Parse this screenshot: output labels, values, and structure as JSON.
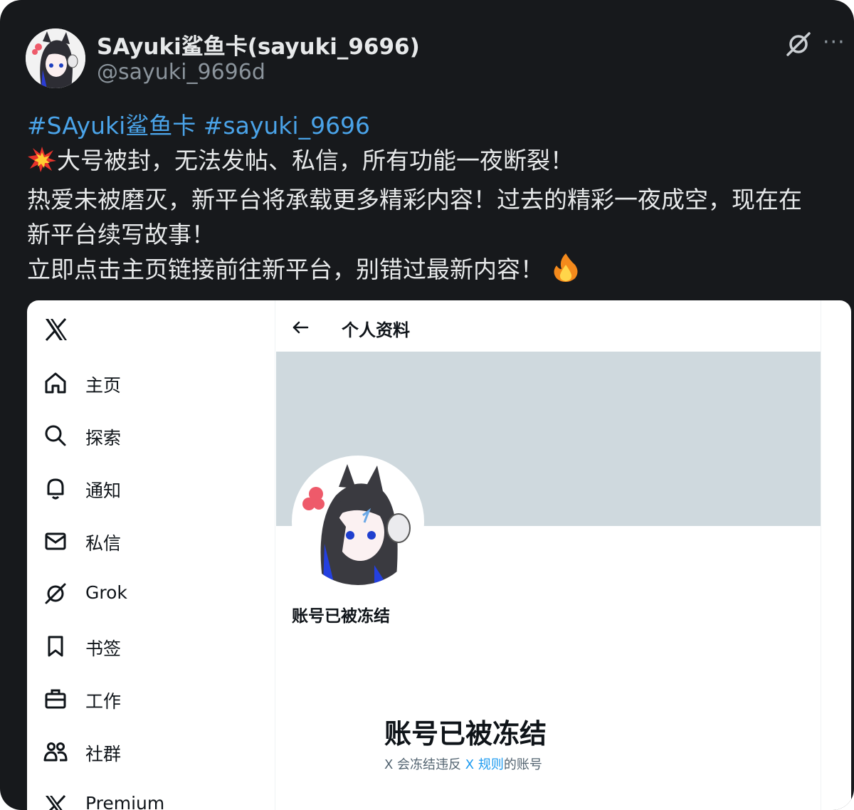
{
  "post": {
    "author_name": "SAyuki鲨鱼卡(sayuki_9696)",
    "author_handle": "@sayuki_9696d",
    "hashtags": [
      "#SAyuki鲨鱼卡",
      "#sayuki_9696"
    ],
    "lines": [
      "大号被封，无法发帖、私信，所有功能一夜断裂！",
      "热爱未被磨灭，新平台将承载更多精彩内容！过去的精彩一夜成空，现在在",
      "新平台续写故事！",
      "立即点击主页链接前往新平台，别错过最新内容！"
    ],
    "emojis": [
      "collision-emoji",
      "fire-emoji"
    ],
    "actions": {
      "grok": "grok-icon",
      "more": "···"
    }
  },
  "embedded_screenshot": {
    "sidebar": {
      "logo": "x-logo-icon",
      "items": [
        {
          "label": "主页",
          "icon": "home-icon"
        },
        {
          "label": "探索",
          "icon": "search-icon"
        },
        {
          "label": "通知",
          "icon": "bell-icon"
        },
        {
          "label": "私信",
          "icon": "mail-icon"
        },
        {
          "label": "Grok",
          "icon": "grok-icon"
        },
        {
          "label": "书签",
          "icon": "bookmark-icon"
        },
        {
          "label": "工作",
          "icon": "briefcase-icon"
        },
        {
          "label": "社群",
          "icon": "people-icon"
        },
        {
          "label": "Premium",
          "icon": "x-logo-icon"
        }
      ]
    },
    "profile": {
      "header_title": "个人资料",
      "display_name": "账号已被冻结",
      "message_title": "账号已被冻结",
      "message_prefix": "X 会冻结违反 ",
      "message_link": "X 规则",
      "message_suffix": "的账号"
    },
    "colors": {
      "banner": "#cfd9de",
      "link": "#1d9bf0",
      "text": "#0f1419",
      "secondary_text": "#536471"
    }
  },
  "colors": {
    "post_background": "#17191c",
    "post_text": "#e7e9ea",
    "hashtag": "#4aa3e8",
    "handle": "#8b949c"
  }
}
